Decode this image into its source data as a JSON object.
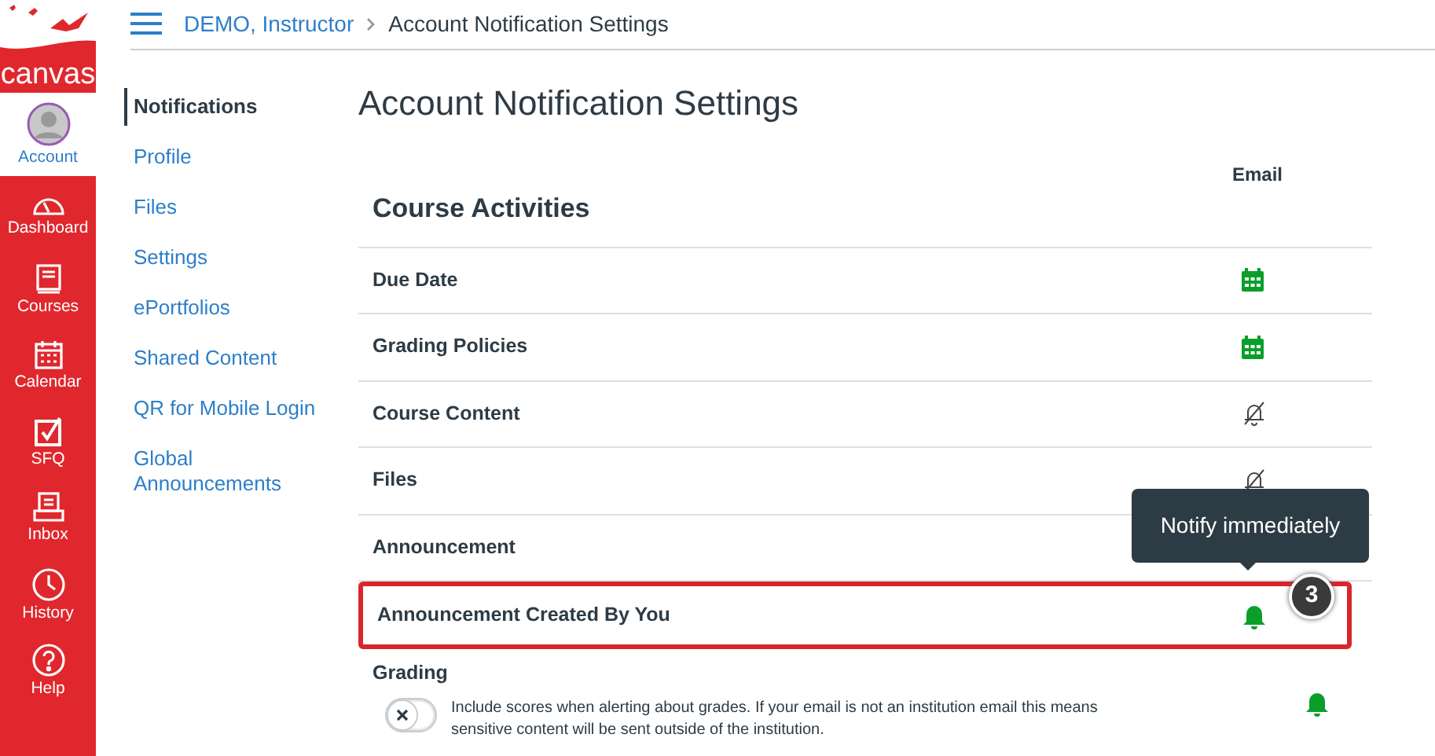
{
  "logo": {
    "text": "canvas"
  },
  "global_nav": [
    {
      "label": "Account",
      "selected": true
    },
    {
      "label": "Dashboard",
      "selected": false
    },
    {
      "label": "Courses",
      "selected": false
    },
    {
      "label": "Calendar",
      "selected": false
    },
    {
      "label": "SFQ",
      "selected": false
    },
    {
      "label": "Inbox",
      "selected": false
    },
    {
      "label": "History",
      "selected": false
    },
    {
      "label": "Help",
      "selected": false
    }
  ],
  "breadcrumb": [
    {
      "label": "DEMO, Instructor",
      "link": true
    },
    {
      "label": "Account Notification Settings",
      "link": false
    }
  ],
  "account_nav": [
    {
      "label": "Notifications",
      "selected": true
    },
    {
      "label": "Profile",
      "selected": false
    },
    {
      "label": "Files",
      "selected": false
    },
    {
      "label": "Settings",
      "selected": false
    },
    {
      "label": "ePortfolios",
      "selected": false
    },
    {
      "label": "Shared Content",
      "selected": false
    },
    {
      "label": "QR for Mobile Login",
      "selected": false
    },
    {
      "label": "Global Announcements",
      "selected": false
    }
  ],
  "page_title": "Account Notification Settings",
  "table": {
    "section": "Course Activities",
    "column": "Email",
    "rows": [
      {
        "label": "Due Date",
        "kind": "daily",
        "highlighted": false
      },
      {
        "label": "Grading Policies",
        "kind": "daily",
        "highlighted": false
      },
      {
        "label": "Course Content",
        "kind": "off",
        "highlighted": false
      },
      {
        "label": "Files",
        "kind": "off",
        "highlighted": false
      },
      {
        "label": "Announcement",
        "kind": "covered",
        "highlighted": false
      },
      {
        "label": "Announcement Created By You",
        "kind": "immediate",
        "highlighted": true
      }
    ]
  },
  "grading": {
    "label": "Grading",
    "toggle_on": false,
    "description": "Include scores when alerting about grades. If your email is not an institution email this means sensitive content will be sent outside of the institution.",
    "kind": "immediate"
  },
  "tooltip": "Notify immediately",
  "step_badge": "3"
}
